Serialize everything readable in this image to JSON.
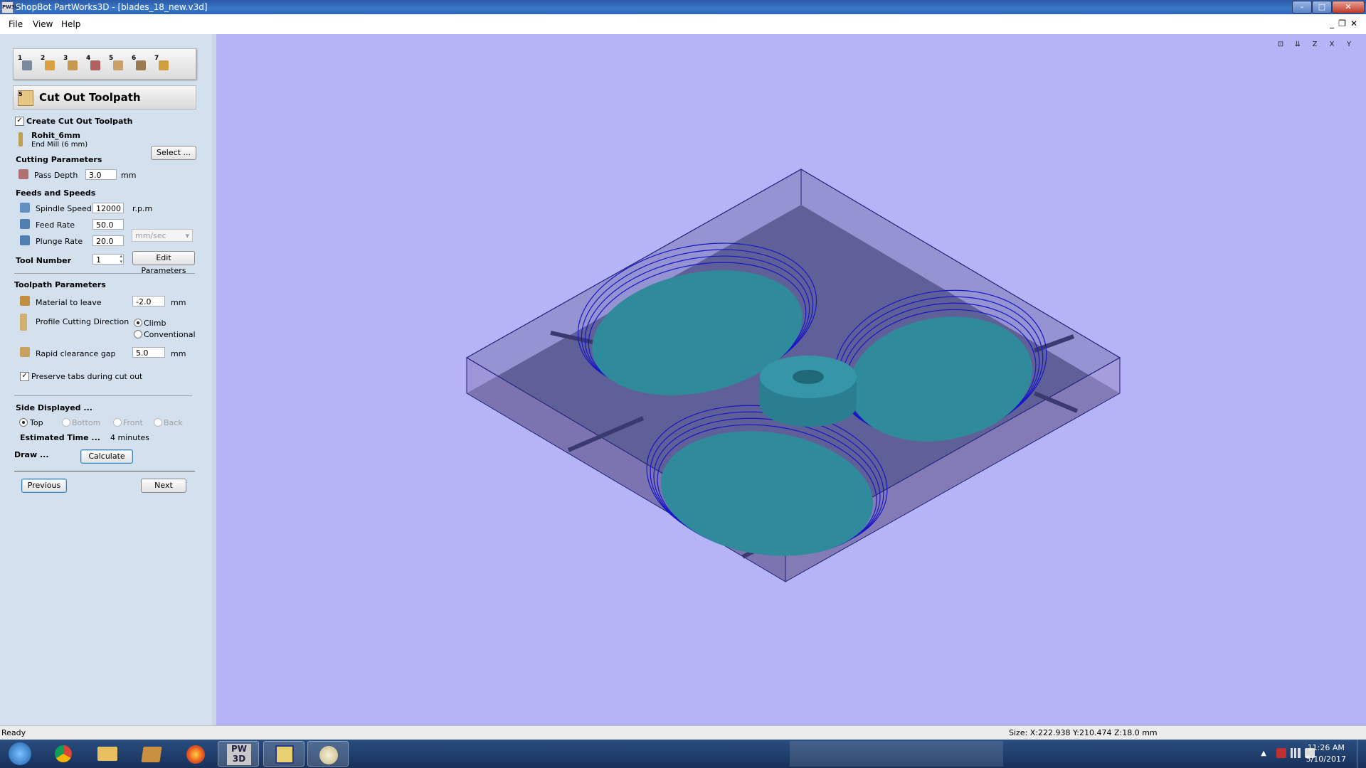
{
  "window": {
    "title": "ShopBot PartWorks3D - [blades_18_new.v3d]",
    "app_icon_text": "PW3D",
    "minimize": "–",
    "maximize": "□",
    "close": "✕"
  },
  "menu": {
    "file": "File",
    "view": "View",
    "help": "Help",
    "mdi_minimize": "_",
    "mdi_restore": "❐",
    "mdi_close": "✕"
  },
  "toolbar": {
    "steps": [
      "1",
      "2",
      "3",
      "4",
      "5",
      "6",
      "7"
    ]
  },
  "panel": {
    "header_step": "5",
    "header_title": "Cut Out Toolpath",
    "create_label": "Create Cut Out Toolpath",
    "create_checked": true,
    "tool_name": "Rohit_6mm",
    "tool_desc": "End Mill (6 mm)",
    "select_button": "Select ...",
    "cutting_params_heading": "Cutting Parameters",
    "pass_depth_label": "Pass Depth",
    "pass_depth_value": "3.0",
    "pass_depth_unit": "mm",
    "feeds_heading": "Feeds and Speeds",
    "spindle_label": "Spindle Speed",
    "spindle_value": "12000",
    "spindle_unit": "r.p.m",
    "feed_label": "Feed Rate",
    "feed_value": "50.0",
    "plunge_label": "Plunge Rate",
    "plunge_value": "20.0",
    "rate_unit": "mm/sec",
    "tool_number_label": "Tool Number",
    "tool_number_value": "1",
    "edit_params_button": "Edit Parameters",
    "toolpath_params_heading": "Toolpath Parameters",
    "material_label": "Material to leave",
    "material_value": "-2.0",
    "material_unit": "mm",
    "profile_label": "Profile Cutting Direction",
    "climb_label": "Climb",
    "conventional_label": "Conventional",
    "profile_selected": "Climb",
    "rapid_label": "Rapid clearance gap",
    "rapid_value": "5.0",
    "rapid_unit": "mm",
    "preserve_tabs_label": "Preserve tabs during cut out",
    "preserve_tabs_checked": true,
    "side_heading": "Side Displayed ...",
    "side_top": "Top",
    "side_bottom": "Bottom",
    "side_front": "Front",
    "side_back": "Back",
    "side_selected": "Top",
    "estimated_label": "Estimated Time ...",
    "estimated_value": "4 minutes",
    "draw_label": "Draw ...",
    "calculate_button": "Calculate",
    "previous_button": "Previous",
    "next_button": "Next"
  },
  "viewport": {
    "view_icons": [
      "fit-view-icon",
      "iso-view-icon",
      "z-view-icon",
      "x-view-icon",
      "y-view-icon"
    ],
    "view_icon_labels": [
      "⊡",
      "⇊",
      "Z",
      "X",
      "Y"
    ],
    "background": "#b4b4f6",
    "part_color": "#2f8a9c",
    "toolpath_color": "#1616c8"
  },
  "status": {
    "left": "Ready",
    "size": "Size: X:222.938 Y:210.474 Z:18.0 mm"
  },
  "taskbar": {
    "items": [
      "start-orb",
      "chrome",
      "explorer",
      "folder-app",
      "firefox",
      "partworks3d",
      "vcarve",
      "paint"
    ],
    "active_label": "PW 3D",
    "time": "11:26 AM",
    "date": "5/10/2017"
  }
}
